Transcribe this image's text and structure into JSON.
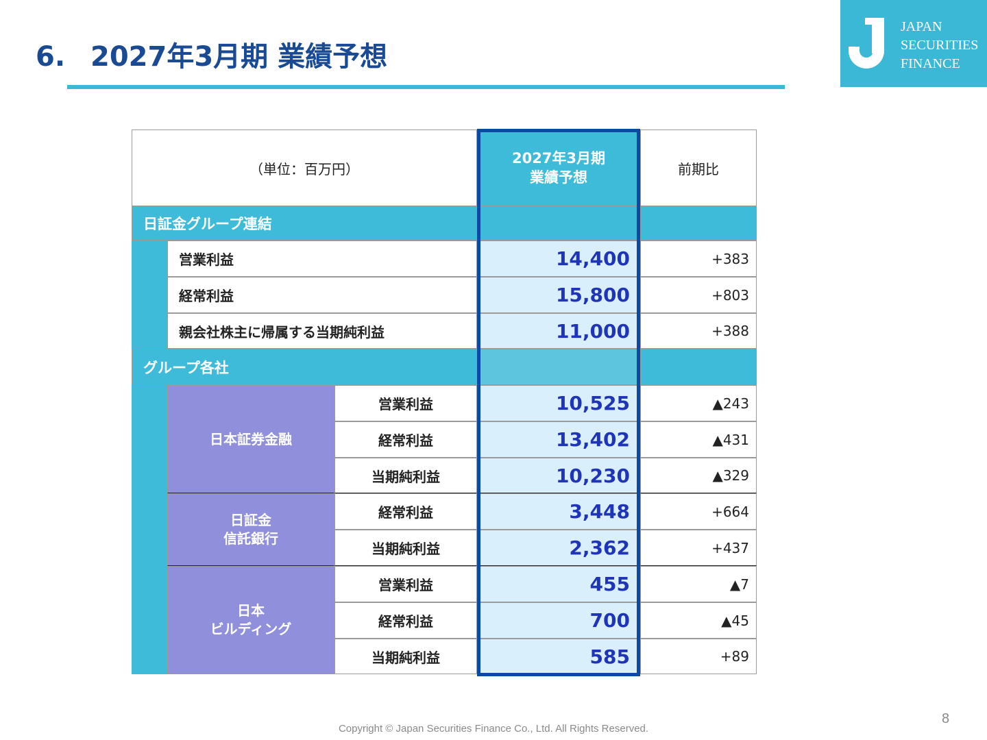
{
  "header": {
    "number": "6.",
    "title": "2027年3月期 業績予想"
  },
  "logo": {
    "lines": [
      "JAPAN",
      "SECURITIES",
      "FINANCE"
    ]
  },
  "table": {
    "unit_label": "（単位：百万円）",
    "forecast_header": "2027年3月期\n業績予想",
    "change_header": "前期比",
    "section_consolidated": "日証金グループ連結",
    "consolidated_rows": [
      {
        "label": "営業利益",
        "value": "14,400",
        "change": "+383"
      },
      {
        "label": "経常利益",
        "value": "15,800",
        "change": "+803"
      },
      {
        "label": "親会社株主に帰属する当期純利益",
        "value": "11,000",
        "change": "+388"
      }
    ],
    "section_companies": "グループ各社",
    "companies": [
      {
        "name": "日本証券金融",
        "rows": [
          {
            "label": "営業利益",
            "value": "10,525",
            "change": "▲243"
          },
          {
            "label": "経常利益",
            "value": "13,402",
            "change": "▲431"
          },
          {
            "label": "当期純利益",
            "value": "10,230",
            "change": "▲329"
          }
        ]
      },
      {
        "name": "日証金\n信託銀行",
        "rows": [
          {
            "label": "経常利益",
            "value": "3,448",
            "change": "+664"
          },
          {
            "label": "当期純利益",
            "value": "2,362",
            "change": "+437"
          }
        ]
      },
      {
        "name": "日本\nビルディング",
        "rows": [
          {
            "label": "営業利益",
            "value": "455",
            "change": "▲7"
          },
          {
            "label": "経常利益",
            "value": "700",
            "change": "▲45"
          },
          {
            "label": "当期純利益",
            "value": "585",
            "change": "+89"
          }
        ]
      }
    ]
  },
  "footer": {
    "copyright": "Copyright © Japan Securities Finance Co., Ltd. All Rights Reserved.",
    "page": "8"
  },
  "colors": {
    "title": "#1a4a93",
    "accent": "#3ab8d6",
    "company_fill": "#8f8fdc",
    "forecast_fill": "#d9effc",
    "forecast_text": "#1f35b8",
    "highlight_border": "#0b4aa2"
  }
}
